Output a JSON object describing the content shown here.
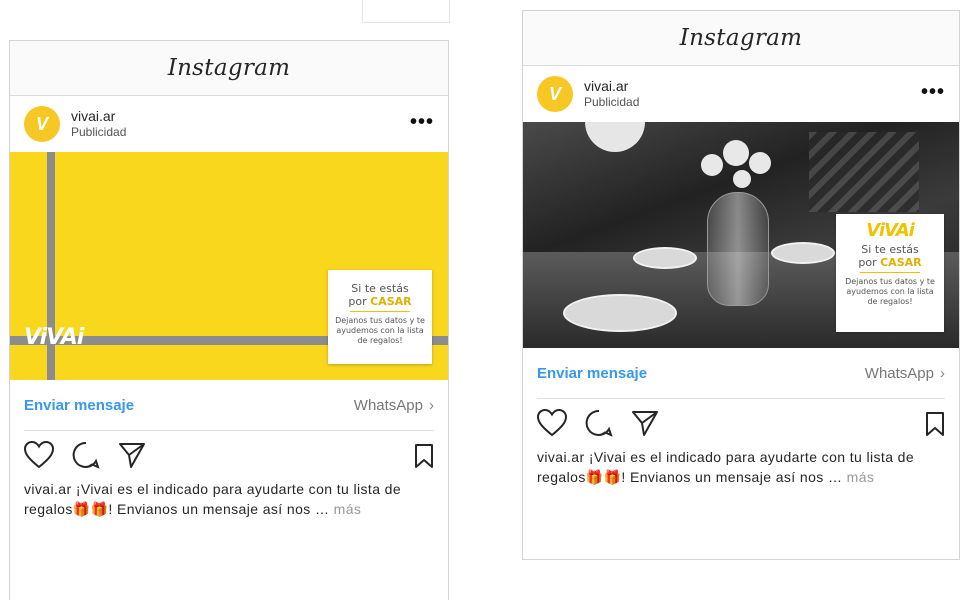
{
  "app": {
    "name": "Instagram"
  },
  "ads": [
    {
      "account": {
        "username": "vivai.ar",
        "label": "Publicidad",
        "avatar_letter": "V"
      },
      "more_icon": "•••",
      "creative": {
        "style": "yellow-gift-ribbon",
        "brand_mark": "ViVAi",
        "card": {
          "line1": "Si te estás",
          "line2_prefix": "por ",
          "line2_highlight": "CASAR",
          "body": "Dejanos tus datos y te ayudemos con la lista de regalos!"
        }
      },
      "cta": {
        "label": "Enviar mensaje",
        "channel": "WhatsApp",
        "chevron": "›"
      },
      "caption": {
        "user": "vivai.ar",
        "text_1": " ¡Vivai es el indicado para ayudarte con tu lista de regalos",
        "gifts": "🎁🎁",
        "text_2": "! Envianos un mensaje así nos …",
        "more": "más"
      }
    },
    {
      "account": {
        "username": "vivai.ar",
        "label": "Publicidad",
        "avatar_letter": "V"
      },
      "more_icon": "•••",
      "creative": {
        "style": "restaurant-table-photo",
        "brand_mark": "ViVAi",
        "card": {
          "line1": "Si te estás",
          "line2_prefix": "por ",
          "line2_highlight": "CASAR",
          "body": "Dejanos tus datos y te ayudemos con la lista de regalos!"
        }
      },
      "cta": {
        "label": "Enviar mensaje",
        "channel": "WhatsApp",
        "chevron": "›"
      },
      "caption": {
        "user": "vivai.ar",
        "text_1": " ¡Vivai es el indicado para ayudarte con tu lista de regalos",
        "gifts": "🎁🎁",
        "text_2": "! Envianos un mensaje así nos …",
        "more": "más"
      }
    }
  ],
  "icons": [
    "heart-icon",
    "comment-icon",
    "share-icon",
    "bookmark-icon",
    "chevron-right-icon",
    "more-options-icon"
  ],
  "colors": {
    "accent": "#3897f0",
    "brand_yellow": "#f9d71c",
    "ribbon_gray": "#8c8c8c"
  }
}
